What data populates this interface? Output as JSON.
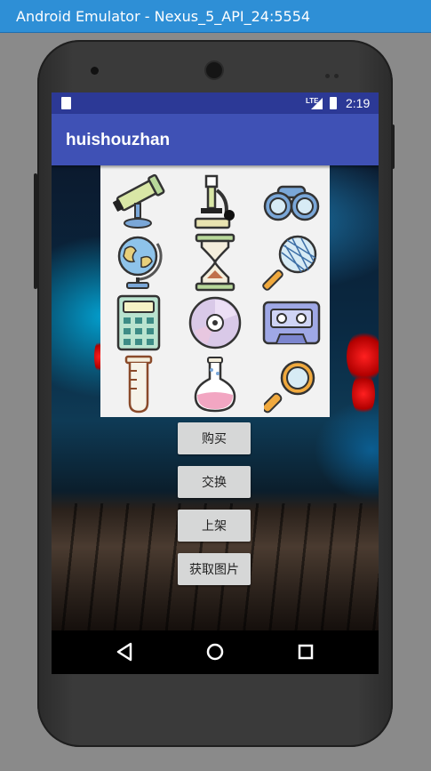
{
  "window": {
    "title": "Android Emulator - Nexus_5_API_24:5554"
  },
  "status_bar": {
    "network": "LTE",
    "time": "2:19"
  },
  "app_bar": {
    "title": "huishouzhan"
  },
  "icons_grid": [
    "telescope-icon",
    "microscope-icon",
    "binoculars-icon",
    "globe-icon",
    "hourglass-icon",
    "butterfly-net-icon",
    "calculator-icon",
    "cd-disc-icon",
    "cassette-tape-icon",
    "test-tube-icon",
    "flask-icon",
    "magnifying-glass-icon"
  ],
  "buttons": {
    "buy": "购买",
    "exchange": "交换",
    "list": "上架",
    "get_image": "获取图片"
  },
  "nav": {
    "back": "back-icon",
    "home": "home-icon",
    "recents": "recents-icon"
  },
  "colors": {
    "titlebar": "#2e8fd6",
    "status_bar": "#2c3996",
    "app_bar": "#3f51b5",
    "button": "#d6d7d7"
  }
}
